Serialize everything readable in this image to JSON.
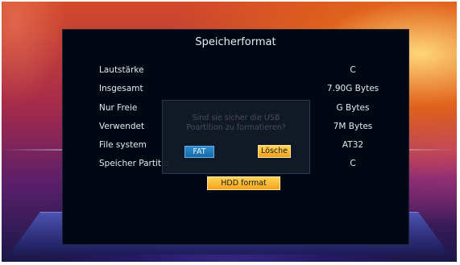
{
  "screen": {
    "title": "Speicherformat"
  },
  "info_rows": [
    {
      "label": "Lautstärke",
      "value": "C"
    },
    {
      "label": "Insgesamt",
      "value": "7.90G Bytes"
    },
    {
      "label": "Nur Freie",
      "value": "G Bytes"
    },
    {
      "label": "Verwendet",
      "value": "7M Bytes"
    },
    {
      "label": "File system",
      "value": "AT32"
    },
    {
      "label": "Speicher Partitio",
      "value": "C"
    }
  ],
  "hdd_button_label": "HDD format",
  "dialog": {
    "line1": "Sind sie sicher die USB",
    "line2": "Poartition zu formatieren?",
    "fat_label": "FAT",
    "losche_label": "Lösche"
  }
}
